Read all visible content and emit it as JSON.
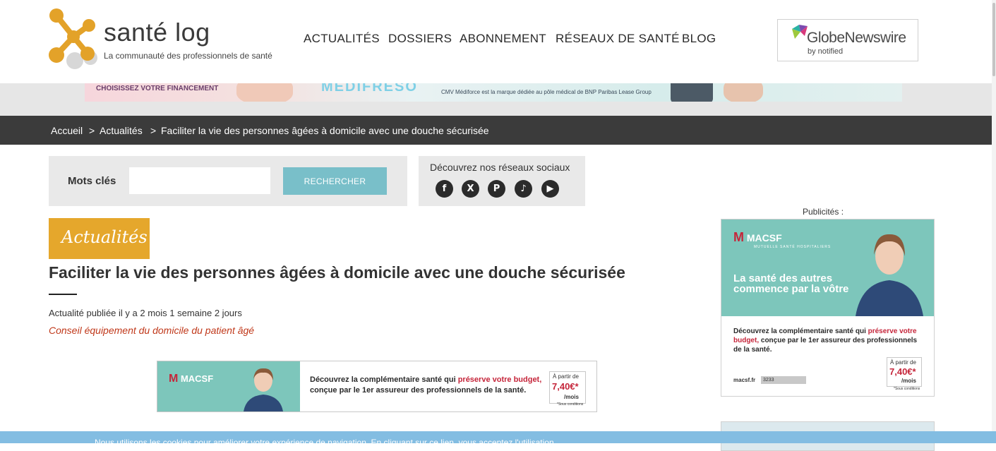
{
  "header": {
    "logo_title": "santé log",
    "logo_tagline": "La communauté des professionnels de santé",
    "nav": [
      "ACTUALITÉS",
      "DOSSIERS",
      "ABONNEMENT",
      "RÉSEAUX DE SANTÉ",
      "BLOG"
    ],
    "partner_name": "GlobeNewswire",
    "partner_sub": "by notified"
  },
  "banner": {
    "cta": "CHOISISSEZ VOTRE FINANCEMENT",
    "brand": "MEDIFRESO",
    "note": "CMV Médiforce est la marque dédiée au pôle médical de BNP Paribas Lease Group"
  },
  "breadcrumb": {
    "items": [
      "Accueil",
      "Actualités",
      "Faciliter la vie des personnes âgées à domicile avec une douche sécurisée"
    ],
    "separator": ">"
  },
  "search": {
    "label": "Mots clés",
    "value": "",
    "placeholder": "",
    "button": "RECHERCHER"
  },
  "social": {
    "title": "Découvrez nos réseaux sociaux",
    "icons": [
      "facebook-icon",
      "x-icon",
      "pinterest-icon",
      "tiktok-icon",
      "youtube-icon"
    ]
  },
  "article": {
    "section": "Actualités",
    "title": "Faciliter la vie des personnes âgées à domicile avec une douche sécurisée",
    "published": "Actualité publiée il y a 2 mois 1 semaine 2 jours",
    "subtitle": "Conseil équipement du domicile du patient âgé"
  },
  "ad_inline": {
    "brand": "MACSF",
    "text_before": "Découvrez la complémentaire santé qui ",
    "text_highlight": "préserve votre budget,",
    "text_after": " conçue par le 1er assureur des professionnels de la santé.",
    "price_prefix": "À partir de",
    "price_value": "7,40€*",
    "price_unit": "/mois",
    "price_note": "*Sous conditions"
  },
  "sidebar": {
    "label": "Publicités :",
    "ad": {
      "brand": "MACSF",
      "brand_sub": "MUTUELLE SANTÉ HOSPITALIERS",
      "headline": "La santé des autres commence par la vôtre",
      "body_before": "Découvrez la complémentaire santé qui ",
      "body_highlight": "préserve votre budget,",
      "body_after": " conçue par le 1er assureur des professionnels de la santé.",
      "url": "macsf.fr",
      "phone": "3233",
      "price_prefix": "À partir de",
      "price_value": "7,40€*",
      "price_unit": "/mois",
      "price_note": "*Sous conditions"
    }
  },
  "cookie": {
    "text": "Nous utilisons les cookies pour améliorer votre expérience de navigation. En cliquant sur ce lien, vous acceptez l'utilisation"
  },
  "colors": {
    "accent": "#e5a72c",
    "breadcrumb_bg": "#3b3b3b",
    "button": "#79bfc9",
    "subtitle": "#c0381a",
    "macsf_teal": "#7dc6bb",
    "macsf_red": "#c5253a",
    "cookie_bar": "#83bde2"
  }
}
